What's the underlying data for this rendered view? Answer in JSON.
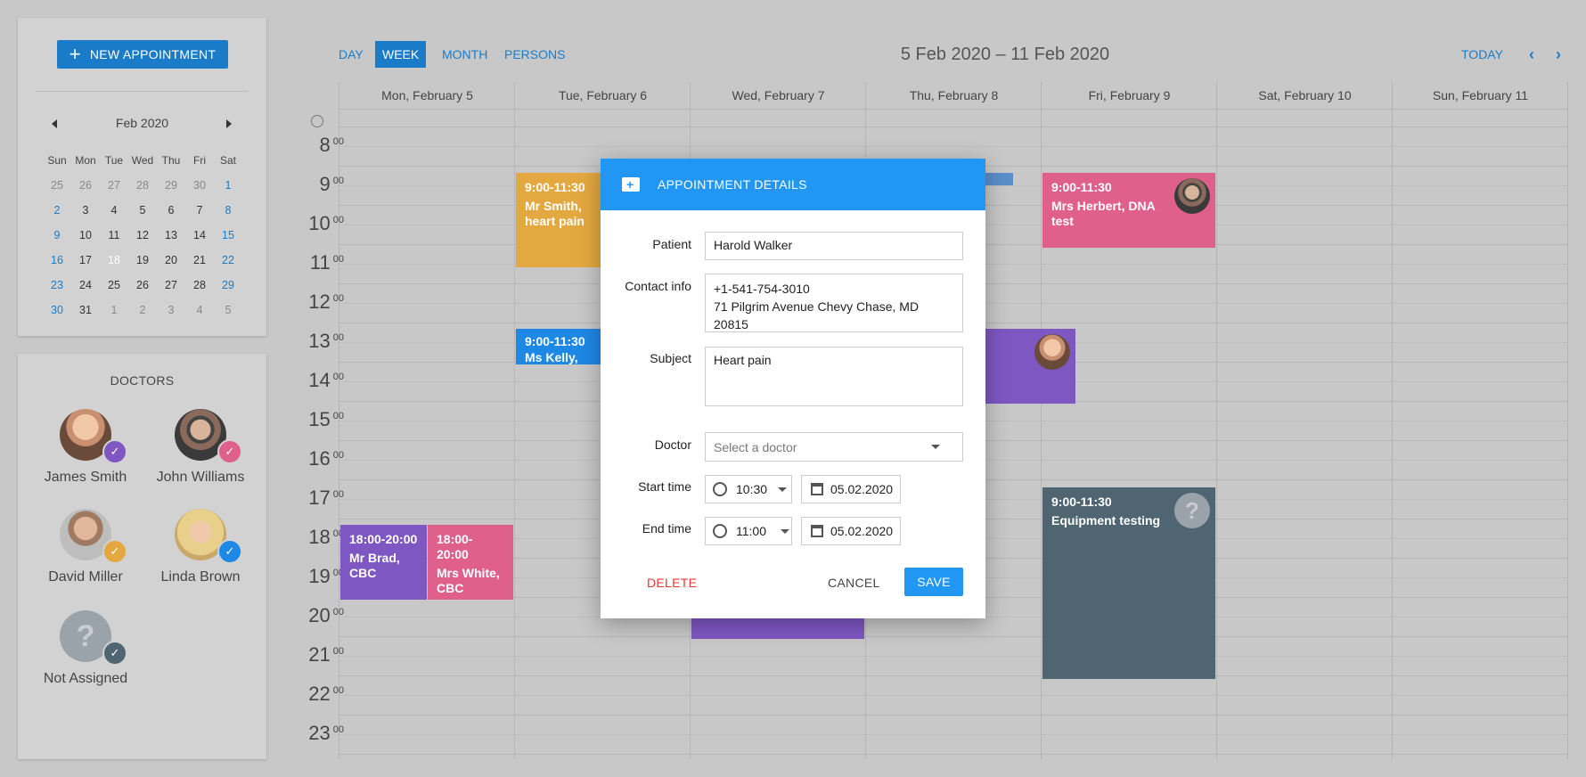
{
  "sidebar": {
    "new_appointment": "NEW APPOINTMENT",
    "calendar_month": "Feb 2020",
    "weekdays": [
      "Sun",
      "Mon",
      "Tue",
      "Wed",
      "Thu",
      "Fri",
      "Sat"
    ],
    "weeks": [
      [
        "25",
        "26",
        "27",
        "28",
        "29",
        "30",
        "1"
      ],
      [
        "2",
        "3",
        "4",
        "5",
        "6",
        "7",
        "8"
      ],
      [
        "9",
        "10",
        "11",
        "12",
        "13",
        "14",
        "15"
      ],
      [
        "16",
        "17",
        "18",
        "19",
        "20",
        "21",
        "22"
      ],
      [
        "23",
        "24",
        "25",
        "26",
        "27",
        "28",
        "29"
      ],
      [
        "30",
        "31",
        "1",
        "2",
        "3",
        "4",
        "5"
      ]
    ],
    "selected_day": "18",
    "doctors_title": "DOCTORS",
    "doctors": [
      {
        "name": "James Smith",
        "color": "#7e57c2"
      },
      {
        "name": "John Williams",
        "color": "#e0608c"
      },
      {
        "name": "David Miller",
        "color": "#e3a840"
      },
      {
        "name": "Linda Brown",
        "color": "#1e88e5"
      },
      {
        "name": "Not Assigned",
        "color": "#4f6672"
      }
    ],
    "not_assigned_symbol": "?"
  },
  "toolbar": {
    "views": [
      "DAY",
      "WEEK",
      "MONTH",
      "PERSONS"
    ],
    "active_view": "WEEK",
    "date_range": "5 Feb 2020 – 11 Feb 2020",
    "today": "TODAY"
  },
  "calendar": {
    "days": [
      "Mon, February 5",
      "Tue, February 6",
      "Wed, February 7",
      "Thu, February 8",
      "Fri, February 9",
      "Sat, February 10",
      "Sun, February 11"
    ],
    "hours": [
      "8",
      "9",
      "10",
      "11",
      "12",
      "13",
      "14",
      "15",
      "16",
      "17",
      "18",
      "19",
      "20",
      "21",
      "22",
      "23"
    ],
    "minutes": "00",
    "appointments": [
      {
        "time": "9:00-11:30",
        "title": "Mr Smith, heart pain",
        "color": "#e3a840"
      },
      {
        "time": "9:00-11:30",
        "title": "Ms Kelly, sore throat",
        "color": "#1e88e5"
      },
      {
        "time": "9:00-11:30",
        "title": "Mrs Herbert, DNA test",
        "color": "#e0608c"
      },
      {
        "time": "9:00-11:30",
        "title": "Equipment testing",
        "color": "#4f6672"
      },
      {
        "time": "18:00-20:00",
        "title": "Mr Brad, CBC",
        "color": "#7e57c2"
      },
      {
        "time": "18:00-20:00",
        "title": "Mrs White, CBC",
        "color": "#e0608c"
      }
    ],
    "unknown_symbol": "?"
  },
  "dialog": {
    "title": "APPOINTMENT DETAILS",
    "patient_label": "Patient",
    "patient_value": "Harold Walker",
    "contact_label": "Contact info",
    "contact_phone": "+1-541-754-3010",
    "contact_address": "71 Pilgrim Avenue Chevy Chase, MD 20815",
    "subject_label": "Subject",
    "subject_value": "Heart pain",
    "doctor_label": "Doctor",
    "doctor_placeholder": "Select a doctor",
    "start_label": "Start time",
    "start_time": "10:30",
    "start_date": "05.02.2020",
    "end_label": "End time",
    "end_time": "11:00",
    "end_date": "05.02.2020",
    "delete": "DELETE",
    "cancel": "CANCEL",
    "save": "SAVE"
  }
}
